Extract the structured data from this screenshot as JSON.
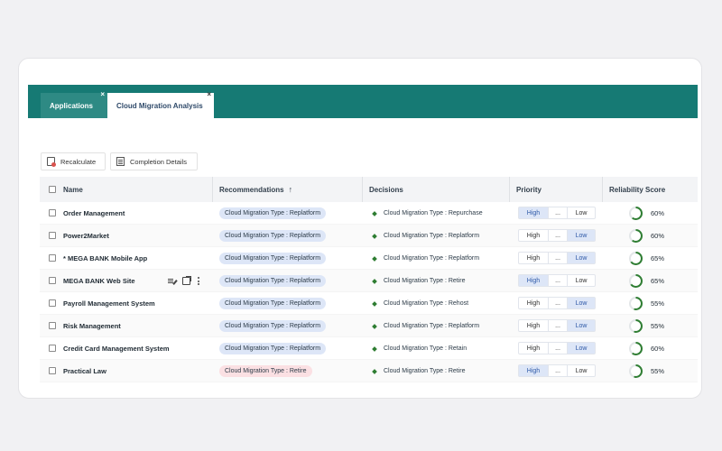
{
  "tabs": [
    {
      "label": "Applications",
      "active": false
    },
    {
      "label": "Cloud Migration Analysis",
      "active": true
    }
  ],
  "tab_close_glyph": "×",
  "toolbar": {
    "recalculate_label": "Recalculate",
    "completion_details_label": "Completion Details"
  },
  "table": {
    "headers": {
      "name": "Name",
      "recommendations": "Recommendations",
      "sort_arrow": "↑",
      "decisions": "Decisions",
      "priority": "Priority",
      "reliability": "Reliability Score"
    },
    "priority_options": {
      "high": "High",
      "mid": "...",
      "low": "Low"
    },
    "rows": [
      {
        "name": "Order Management",
        "recommendation": "Cloud Migration Type : Replatform",
        "rec_color": "blue",
        "decision": "Cloud Migration Type : Repurchase",
        "priority": "high",
        "score": "60%",
        "score_value": 60
      },
      {
        "name": "Power2Market",
        "recommendation": "Cloud Migration Type : Replatform",
        "rec_color": "blue",
        "decision": "Cloud Migration Type : Replatform",
        "priority": "low",
        "score": "60%",
        "score_value": 60
      },
      {
        "name": "* MEGA BANK Mobile App",
        "recommendation": "Cloud Migration Type : Replatform",
        "rec_color": "blue",
        "decision": "Cloud Migration Type : Replatform",
        "priority": "low",
        "score": "65%",
        "score_value": 65
      },
      {
        "name": "MEGA BANK Web Site",
        "recommendation": "Cloud Migration Type : Replatform",
        "rec_color": "blue",
        "decision": "Cloud Migration Type : Retire",
        "priority": "high",
        "score": "65%",
        "score_value": 65,
        "show_actions": true
      },
      {
        "name": "Payroll Management System",
        "recommendation": "Cloud Migration Type : Replatform",
        "rec_color": "blue",
        "decision": "Cloud Migration Type : Rehost",
        "priority": "low",
        "score": "55%",
        "score_value": 55
      },
      {
        "name": "Risk Management",
        "recommendation": "Cloud Migration Type : Replatform",
        "rec_color": "blue",
        "decision": "Cloud Migration Type : Replatform",
        "priority": "low",
        "score": "55%",
        "score_value": 55
      },
      {
        "name": "Credit Card Management System",
        "recommendation": "Cloud Migration Type : Replatform",
        "rec_color": "blue",
        "decision": "Cloud Migration Type : Retain",
        "priority": "low",
        "score": "60%",
        "score_value": 60
      },
      {
        "name": "Practical Law",
        "recommendation": "Cloud Migration Type : Retire",
        "rec_color": "pink",
        "decision": "Cloud Migration Type : Retire",
        "priority": "high",
        "score": "55%",
        "score_value": 55
      }
    ]
  },
  "colors": {
    "brand": "#167a74",
    "ring": "#2e7d32",
    "ring_track": "#e3e6e8",
    "pill_blue": "#dde6f7",
    "pill_pink": "#fbe0e3"
  }
}
